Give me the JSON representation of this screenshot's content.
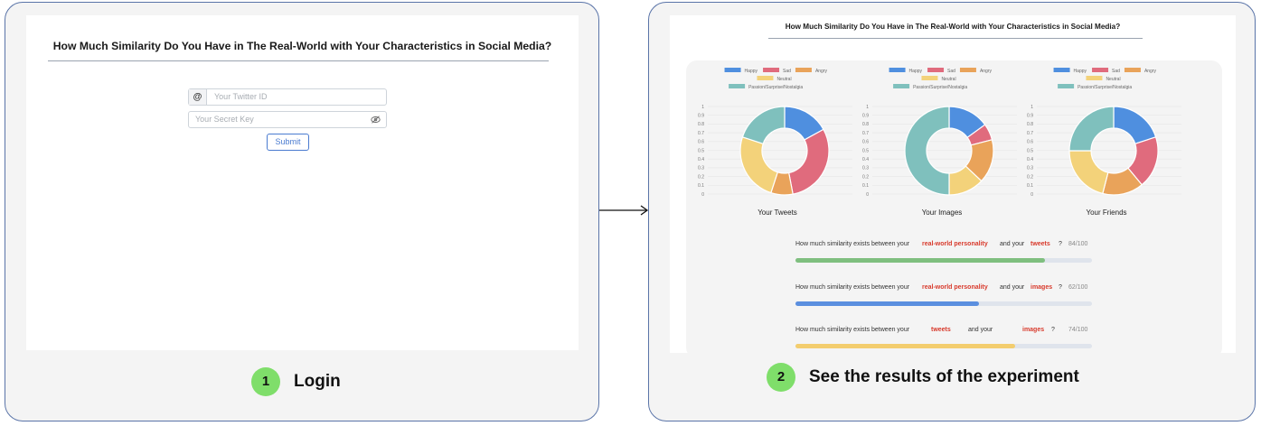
{
  "login": {
    "title": "How Much Similarity Do You Have in The Real-World with Your Characteristics in Social Media?",
    "at_symbol": "@",
    "id_placeholder": "Your Twitter ID",
    "key_placeholder": "Your Secret Key",
    "submit_label": "Submit"
  },
  "steps": [
    {
      "number": "1",
      "label": "Login"
    },
    {
      "number": "2",
      "label": "See the results of the experiment"
    }
  ],
  "results": {
    "title": "How Much Similarity Do You Have in The Real-World with Your Characteristics in Social Media?",
    "legend": [
      {
        "label": "Happy",
        "color": "#4f8fdf"
      },
      {
        "label": "Sad",
        "color": "#e06b7d"
      },
      {
        "label": "Angry",
        "color": "#e9a35a"
      },
      {
        "label": "Neutral",
        "color": "#f3d27a"
      },
      {
        "label": "Passion/Surprise/Nostalgia",
        "color": "#7fc0bd"
      }
    ],
    "y_ticks": [
      "1",
      "0.9",
      "0.8",
      "0.7",
      "0.6",
      "0.5",
      "0.4",
      "0.3",
      "0.2",
      "0.1",
      "0"
    ],
    "questions": [
      {
        "prefix": "How much similarity exists between your",
        "a": "real-world personality",
        "mid": "and your",
        "b": "tweets",
        "q": "?",
        "score": "84/100",
        "value": 0.84,
        "color": "#7fbf7f"
      },
      {
        "prefix": "How much similarity exists between your",
        "a": "real-world personality",
        "mid": "and your",
        "b": "images",
        "q": "?",
        "score": "62/100",
        "value": 0.62,
        "color": "#5b8fdf"
      },
      {
        "prefix": "How much similarity exists between your",
        "a": "tweets",
        "mid": "and your",
        "b": "images",
        "q": "?",
        "score": "74/100",
        "value": 0.74,
        "color": "#f3cd6e"
      }
    ]
  },
  "chart_data": [
    {
      "type": "pie",
      "title": "Your Tweets",
      "categories": [
        "Happy",
        "Sad",
        "Angry",
        "Neutral",
        "Passion/Surprise/Nostalgia"
      ],
      "values": [
        0.17,
        0.3,
        0.08,
        0.25,
        0.2
      ]
    },
    {
      "type": "pie",
      "title": "Your Images",
      "categories": [
        "Happy",
        "Sad",
        "Angry",
        "Neutral",
        "Passion/Surprise/Nostalgia"
      ],
      "values": [
        0.15,
        0.06,
        0.16,
        0.13,
        0.5
      ]
    },
    {
      "type": "pie",
      "title": "Your Friends",
      "categories": [
        "Happy",
        "Sad",
        "Angry",
        "Neutral",
        "Passion/Surprise/Nostalgia"
      ],
      "values": [
        0.2,
        0.19,
        0.15,
        0.21,
        0.25
      ]
    }
  ]
}
